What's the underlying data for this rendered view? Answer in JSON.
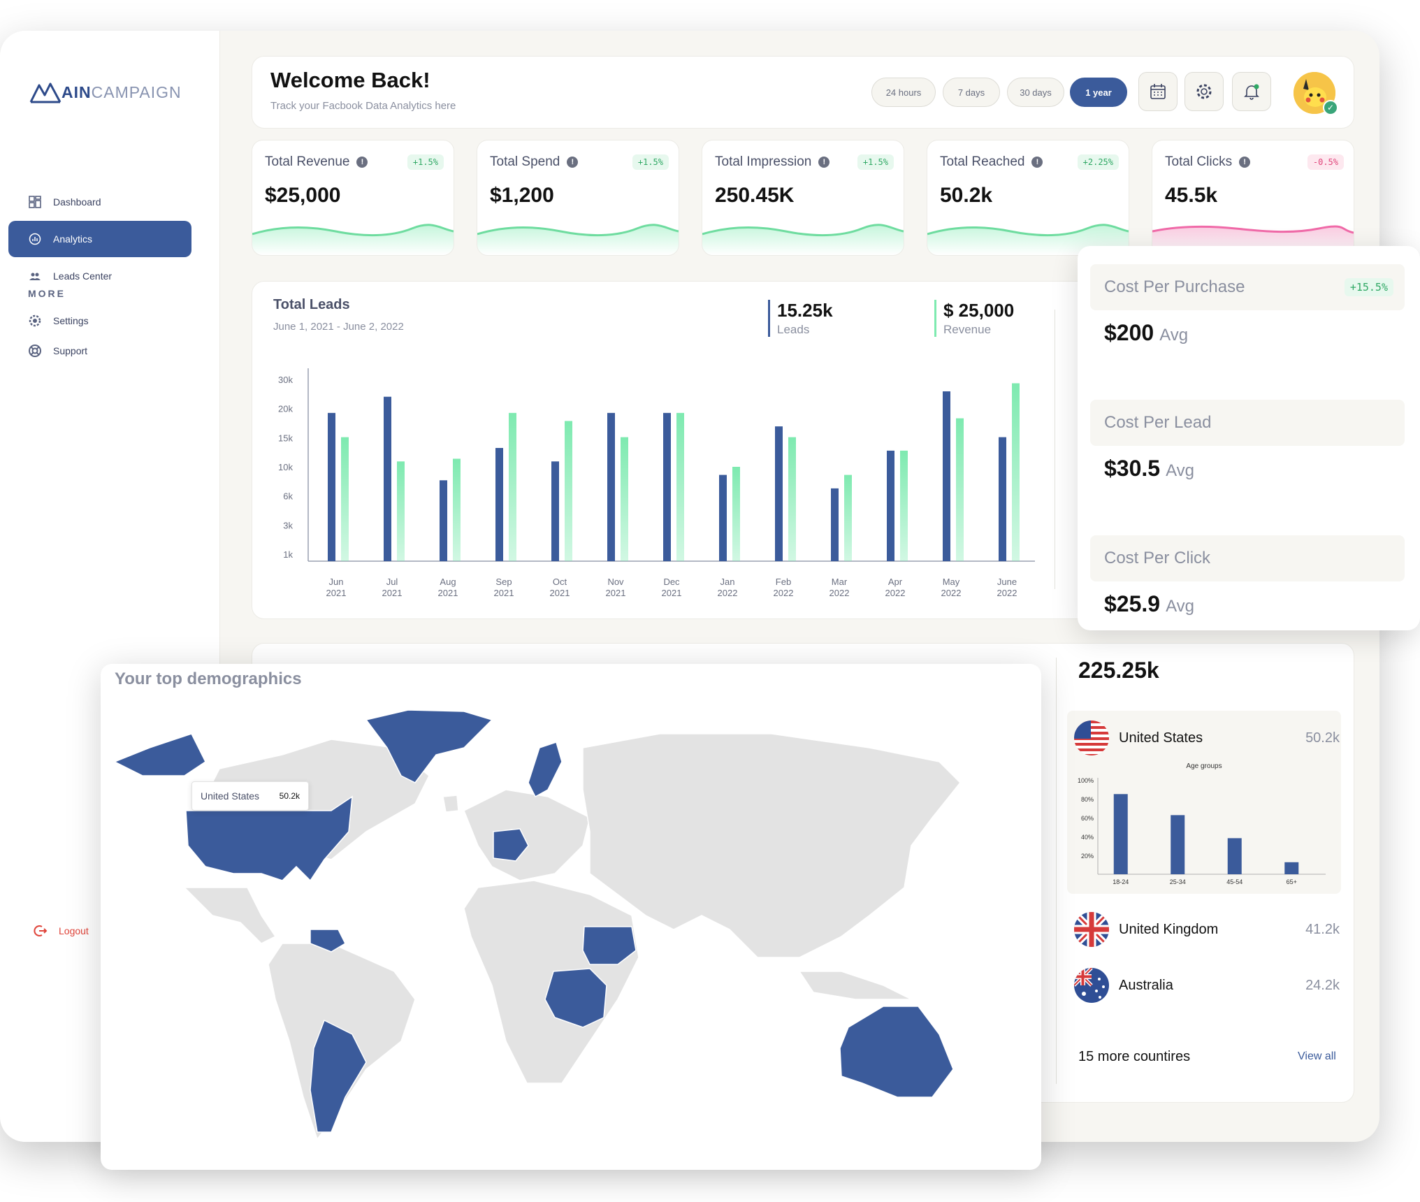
{
  "brand": {
    "logo_bold": "AIN",
    "logo_light": "CAMPAIGN"
  },
  "sidebar": {
    "items": [
      {
        "label": "Dashboard",
        "icon": "grid-icon"
      },
      {
        "label": "Analytics",
        "icon": "analytics-icon",
        "active": true
      },
      {
        "label": "Leads Center",
        "icon": "users-icon"
      }
    ],
    "more_label": "MORE",
    "more_items": [
      {
        "label": "Settings",
        "icon": "settings-icon"
      },
      {
        "label": "Support",
        "icon": "support-icon"
      }
    ],
    "logout_label": "Logout"
  },
  "header": {
    "title": "Welcome Back!",
    "subtitle": "Track your Facbook Data Analytics here",
    "ranges": [
      "24 hours",
      "7 days",
      "30 days",
      "1 year"
    ],
    "active_range": "1 year"
  },
  "stats": [
    {
      "label": "Total Revenue",
      "value": "$25,000",
      "delta": "+1.5%",
      "trend": "positive"
    },
    {
      "label": "Total Spend",
      "value": "$1,200",
      "delta": "+1.5%",
      "trend": "positive"
    },
    {
      "label": "Total Impression",
      "value": "250.45K",
      "delta": "+1.5%",
      "trend": "positive"
    },
    {
      "label": "Total Reached",
      "value": "50.2k",
      "delta": "+2.25%",
      "trend": "positive"
    },
    {
      "label": "Total Clicks",
      "value": "45.5k",
      "delta": "-0.5%",
      "trend": "negative"
    }
  ],
  "leads": {
    "title": "Total Leads",
    "date_range": "June 1, 2021 - June 2, 2022",
    "kpis": [
      {
        "value": "15.25k",
        "label": "Leads",
        "color": "#3b5b9b"
      },
      {
        "value": "$ 25,000",
        "label": "Revenue",
        "color": "#7eeab0"
      }
    ]
  },
  "chart_data": [
    {
      "type": "bar",
      "categories": [
        "Jun 2021",
        "Jul 2021",
        "Aug 2021",
        "Sep 2021",
        "Oct 2021",
        "Nov 2021",
        "Dec 2021",
        "Jan 2022",
        "Feb 2022",
        "Mar 2022",
        "Apr 2022",
        "May 2022",
        "June 2022"
      ],
      "y_ticks": [
        "30k",
        "20k",
        "15k",
        "10k",
        "6k",
        "3k",
        "1k"
      ],
      "series": [
        {
          "name": "Leads",
          "color": "#3b5b9b",
          "values": [
            5.5,
            6.1,
            3.0,
            4.2,
            3.7,
            5.5,
            5.5,
            3.2,
            5.0,
            2.7,
            4.1,
            6.3,
            4.6
          ]
        },
        {
          "name": "Revenue",
          "color": "#7eeab0",
          "values": [
            4.6,
            3.7,
            3.8,
            5.5,
            5.2,
            4.6,
            5.5,
            3.5,
            4.6,
            3.2,
            4.1,
            5.3,
            6.6
          ]
        }
      ]
    },
    {
      "type": "bar",
      "title": "Age groups",
      "categories": [
        "18-24",
        "25-34",
        "45-54",
        "65+"
      ],
      "y_ticks": [
        "100%",
        "80%",
        "60%",
        "40%",
        "20%"
      ],
      "values": [
        80,
        59,
        36,
        12
      ]
    }
  ],
  "cost": [
    {
      "label": "Cost Per Purchase",
      "value": "$200",
      "suffix": "Avg",
      "delta": "+15.5%"
    },
    {
      "label": "Cost Per Lead",
      "value": "$30.5",
      "suffix": "Avg"
    },
    {
      "label": "Cost Per Click",
      "value": "$25.9",
      "suffix": "Avg"
    }
  ],
  "demographics": {
    "title": "Your top demographics",
    "total": "225.25k",
    "tooltip": {
      "country": "United States",
      "value": "50.2k"
    },
    "countries": [
      {
        "name": "United States",
        "value": "50.2k",
        "flag": "us-flag-icon"
      },
      {
        "name": "United Kingdom",
        "value": "41.2k",
        "flag": "uk-flag-icon"
      },
      {
        "name": "Australia",
        "value": "24.2k",
        "flag": "au-flag-icon"
      }
    ],
    "more": "15 more countires",
    "view_all": "View all"
  },
  "colors": {
    "accent": "#3b5b9b",
    "mint": "#7eeab0",
    "pink": "#f06aa8",
    "land": "#e3e3e3"
  }
}
